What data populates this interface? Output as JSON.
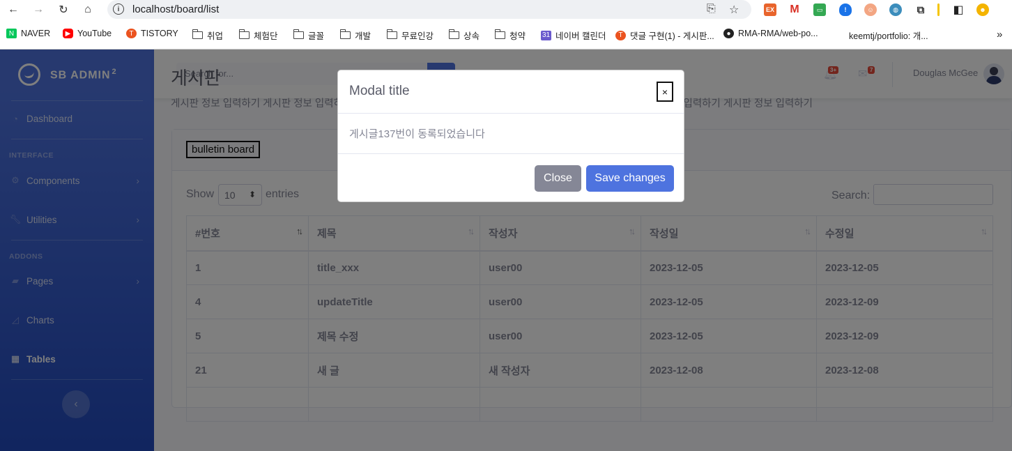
{
  "browser": {
    "url": "localhost/board/list",
    "bookmarks": [
      {
        "label": "NAVER"
      },
      {
        "label": "YouTube"
      },
      {
        "label": "TISTORY"
      },
      {
        "label": "취업"
      },
      {
        "label": "체험단"
      },
      {
        "label": "글꼴"
      },
      {
        "label": "개발"
      },
      {
        "label": "무료인강"
      },
      {
        "label": "상속"
      },
      {
        "label": "청약"
      },
      {
        "label": "네이버 캘린더"
      },
      {
        "label": "댓글 구현(1) - 게시판..."
      },
      {
        "label": "RMA-RMA/web-po..."
      },
      {
        "label": "keemtj/portfolio: 개..."
      }
    ]
  },
  "sidebar": {
    "brand": "SB ADMIN",
    "brand_sup": "2",
    "dashboard": "Dashboard",
    "heading_interface": "INTERFACE",
    "components": "Components",
    "utilities": "Utilities",
    "heading_addons": "ADDONS",
    "pages": "Pages",
    "charts": "Charts",
    "tables": "Tables"
  },
  "topbar": {
    "search_placeholder": "Search for...",
    "alerts_count": "3+",
    "messages_count": "7",
    "user_name": "Douglas McGee"
  },
  "page": {
    "title": "게시판",
    "description": "게시판 정보 입력하기 게시판 정보 입력하기 게시판 정보 입력하기 게시판 정보 입력하기 게시판 정보 입력하기 게시판 정보 입력하기 게시판 정보 입력하기"
  },
  "card": {
    "header_title": "bulletin board",
    "show_label": "Show",
    "entries_value": "10",
    "entries_label": "entries",
    "search_label": "Search:"
  },
  "table": {
    "columns": [
      "#번호",
      "제목",
      "작성자",
      "작성일",
      "수정일"
    ],
    "rows": [
      [
        "1",
        "title_xxx",
        "user00",
        "2023-12-05",
        "2023-12-05"
      ],
      [
        "4",
        "updateTitle",
        "user00",
        "2023-12-05",
        "2023-12-09"
      ],
      [
        "5",
        "제목 수정",
        "user00",
        "2023-12-05",
        "2023-12-09"
      ],
      [
        "21",
        "새 글",
        "새 작성자",
        "2023-12-08",
        "2023-12-08"
      ]
    ]
  },
  "modal": {
    "title": "Modal title",
    "close_x": "×",
    "body": "게시글137번이 동록되었습니다",
    "close_button": "Close",
    "save_button": "Save changes"
  }
}
